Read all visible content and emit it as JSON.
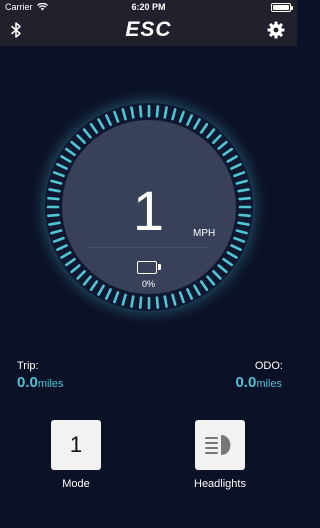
{
  "status_bar": {
    "carrier": "Carrier",
    "time": "6:20 PM"
  },
  "header": {
    "title": "ESC"
  },
  "gauge": {
    "speed": "1",
    "unit": "MPH",
    "battery_percent": "0%",
    "ring_color": "#4fc6d3"
  },
  "stats": {
    "trip_label": "Trip:",
    "trip_value": "0.0",
    "trip_unit": "miles",
    "odo_label": "ODO:",
    "odo_value": "0.0",
    "odo_unit": "miles"
  },
  "controls": {
    "mode_value": "1",
    "mode_label": "Mode",
    "headlights_label": "Headlights"
  },
  "colors": {
    "accent": "#52c0d1",
    "background": "#0b1126",
    "bar": "#20212b"
  }
}
